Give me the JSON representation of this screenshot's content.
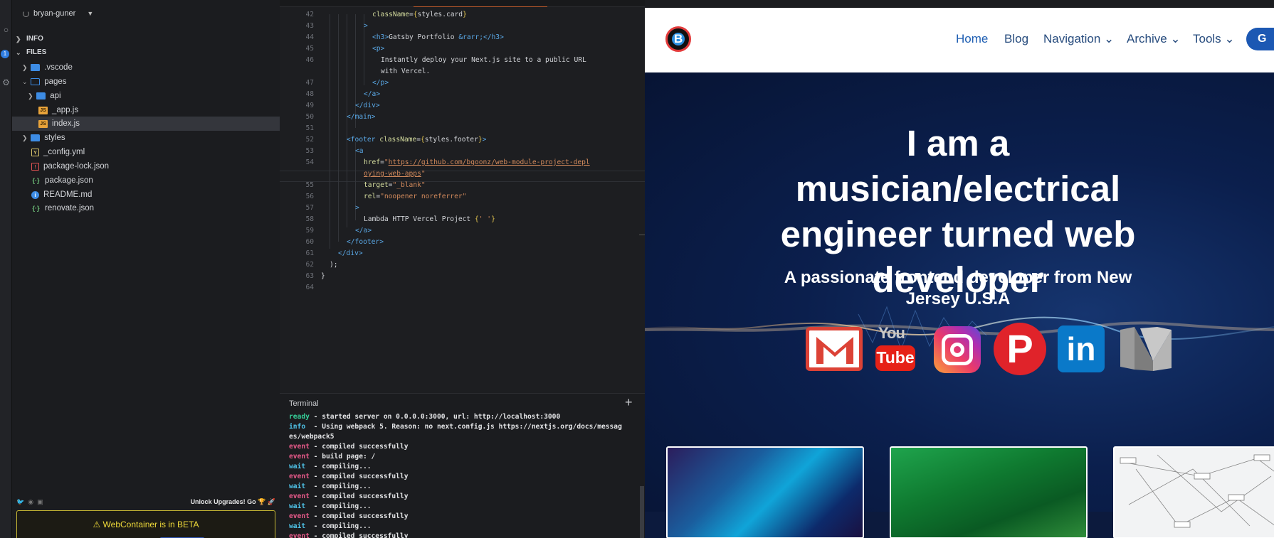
{
  "sidebar": {
    "user": "bryan-guner",
    "sections": {
      "info": "INFO",
      "files": "FILES"
    },
    "badge": "1",
    "items": [
      {
        "label": ".vscode"
      },
      {
        "label": "pages"
      },
      {
        "label": "api"
      },
      {
        "label": "_app.js"
      },
      {
        "label": "index.js"
      },
      {
        "label": "styles"
      },
      {
        "label": "_config.yml"
      },
      {
        "label": "package-lock.json"
      },
      {
        "label": "package.json"
      },
      {
        "label": "README.md"
      },
      {
        "label": "renovate.json"
      }
    ],
    "upgrade_text": "Unlock Upgrades! Go 🏆 🚀",
    "beta_text": "⚠ WebContainer is in BETA"
  },
  "editor": {
    "lines": [
      {
        "n": "42",
        "parts": [
          {
            "c": "a",
            "t": "className"
          },
          {
            "c": "w",
            "t": "="
          },
          {
            "c": "b",
            "t": "{"
          },
          {
            "c": "w",
            "t": "styles.card"
          },
          {
            "c": "b",
            "t": "}"
          }
        ]
      },
      {
        "n": "43",
        "parts": [
          {
            "c": "t",
            "t": ">"
          }
        ]
      },
      {
        "n": "44",
        "parts": [
          {
            "c": "t",
            "t": "<h3>"
          },
          {
            "c": "w",
            "t": "Gatsby Portfolio "
          },
          {
            "c": "t",
            "t": "&rarr;"
          },
          {
            "c": "t",
            "t": "</h3>"
          }
        ]
      },
      {
        "n": "45",
        "parts": [
          {
            "c": "t",
            "t": "<p>"
          }
        ]
      },
      {
        "n": "46",
        "parts": [
          {
            "c": "w",
            "t": "Instantly deploy your Next.js site to a public URL"
          }
        ]
      },
      {
        "n": "",
        "parts": [
          {
            "c": "w",
            "t": "with Vercel."
          }
        ]
      },
      {
        "n": "47",
        "parts": [
          {
            "c": "t",
            "t": "</p>"
          }
        ]
      },
      {
        "n": "48",
        "parts": [
          {
            "c": "t",
            "t": "</a>"
          }
        ]
      },
      {
        "n": "49",
        "parts": [
          {
            "c": "t",
            "t": "</div>"
          }
        ]
      },
      {
        "n": "50",
        "parts": [
          {
            "c": "t",
            "t": "</main>"
          }
        ]
      },
      {
        "n": "51",
        "parts": []
      },
      {
        "n": "52",
        "parts": [
          {
            "c": "t",
            "t": "<footer "
          },
          {
            "c": "a",
            "t": "className"
          },
          {
            "c": "w",
            "t": "="
          },
          {
            "c": "b",
            "t": "{"
          },
          {
            "c": "w",
            "t": "styles.footer"
          },
          {
            "c": "b",
            "t": "}"
          },
          {
            "c": "t",
            "t": ">"
          }
        ]
      },
      {
        "n": "53",
        "parts": [
          {
            "c": "t",
            "t": "<a"
          }
        ]
      },
      {
        "n": "54",
        "parts": [
          {
            "c": "a",
            "t": "href"
          },
          {
            "c": "w",
            "t": "="
          },
          {
            "c": "s",
            "t": "\""
          },
          {
            "c": "u",
            "t": "https://github.com/bgoonz/web-module-project-depl"
          }
        ]
      },
      {
        "n": "",
        "parts": [
          {
            "c": "u",
            "t": "oying-web-apps"
          },
          {
            "c": "s",
            "t": "\""
          }
        ]
      },
      {
        "n": "55",
        "parts": [
          {
            "c": "a",
            "t": "target"
          },
          {
            "c": "w",
            "t": "="
          },
          {
            "c": "s",
            "t": "\"_blank\""
          }
        ]
      },
      {
        "n": "56",
        "parts": [
          {
            "c": "a",
            "t": "rel"
          },
          {
            "c": "w",
            "t": "="
          },
          {
            "c": "s",
            "t": "\"noopener noreferrer\""
          }
        ]
      },
      {
        "n": "57",
        "parts": [
          {
            "c": "t",
            "t": ">"
          }
        ]
      },
      {
        "n": "58",
        "parts": [
          {
            "c": "w",
            "t": "Lambda HTTP Vercel Project "
          },
          {
            "c": "b",
            "t": "{"
          },
          {
            "c": "s",
            "t": "' '"
          },
          {
            "c": "b",
            "t": "}"
          }
        ]
      },
      {
        "n": "59",
        "parts": [
          {
            "c": "t",
            "t": "</a>"
          }
        ]
      },
      {
        "n": "60",
        "parts": [
          {
            "c": "t",
            "t": "</footer>"
          }
        ]
      },
      {
        "n": "61",
        "parts": [
          {
            "c": "t",
            "t": "</div>"
          }
        ]
      },
      {
        "n": "62",
        "parts": [
          {
            "c": "w",
            "t": ");"
          }
        ]
      },
      {
        "n": "63",
        "parts": [
          {
            "c": "w",
            "t": "}"
          }
        ]
      },
      {
        "n": "64",
        "parts": []
      }
    ]
  },
  "terminal": {
    "title": "Terminal",
    "lines": [
      {
        "k": "ready",
        "t": " - started server on 0.0.0.0:3000, url: http://localhost:3000"
      },
      {
        "k": "info",
        "t": "  - Using webpack 5. Reason: no next.config.js https://nextjs.org/docs/messag"
      },
      {
        "k": "",
        "t": "es/webpack5"
      },
      {
        "k": "event",
        "t": " - compiled successfully"
      },
      {
        "k": "event",
        "t": " - build page: /"
      },
      {
        "k": "wait",
        "t": "  - compiling..."
      },
      {
        "k": "event",
        "t": " - compiled successfully"
      },
      {
        "k": "wait",
        "t": "  - compiling..."
      },
      {
        "k": "event",
        "t": " - compiled successfully"
      },
      {
        "k": "wait",
        "t": "  - compiling..."
      },
      {
        "k": "event",
        "t": " - compiled successfully"
      },
      {
        "k": "wait",
        "t": "  - compiling..."
      },
      {
        "k": "event",
        "t": " - compiled successfully"
      }
    ]
  },
  "preview": {
    "logo_letter": "B",
    "nav": [
      "Home",
      "Blog",
      "Navigation ⌄",
      "Archive ⌄",
      "Tools ⌄"
    ],
    "nav_button": "G",
    "hero_title": "I am a musician/electrical engineer turned web developer",
    "hero_subtitle": "A passionate frontend developer from New Jersey U.S.A",
    "social": {
      "youtube_top": "You",
      "youtube_bottom": "Tube",
      "pinterest": "P",
      "linkedin": "in"
    }
  }
}
